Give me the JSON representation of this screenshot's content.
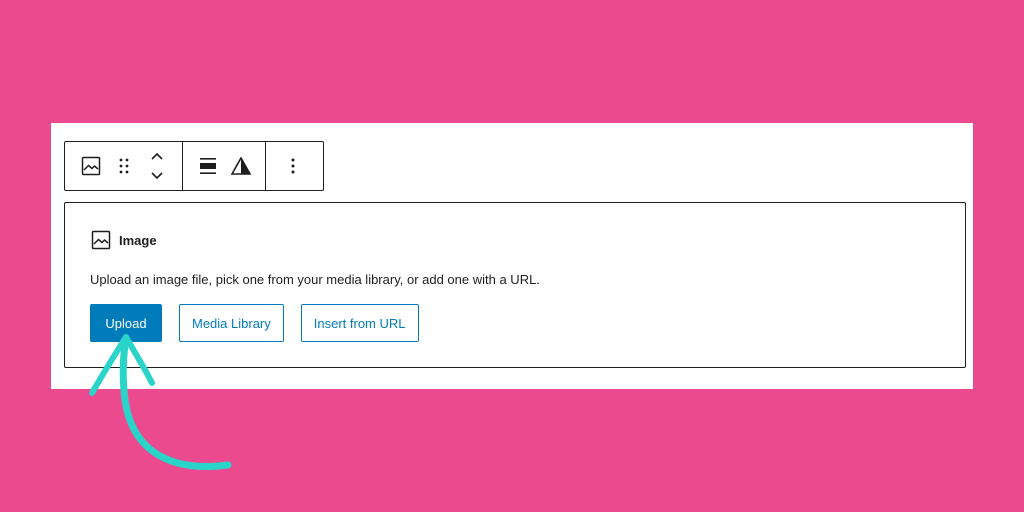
{
  "colors": {
    "background": "#eb4a8f",
    "panel": "#ffffff",
    "primary": "#007cba",
    "border": "#1e1e1e",
    "arrow": "#2ad4c8"
  },
  "toolbar": {
    "icons": [
      "image-icon",
      "drag-handle-icon",
      "move-up-down-icon",
      "align-icon",
      "triangle-icon",
      "more-options-icon"
    ]
  },
  "block": {
    "title": "Image",
    "description": "Upload an image file, pick one from your media library, or add one with a URL.",
    "buttons": {
      "upload": "Upload",
      "media_library": "Media Library",
      "insert_url": "Insert from URL"
    }
  }
}
